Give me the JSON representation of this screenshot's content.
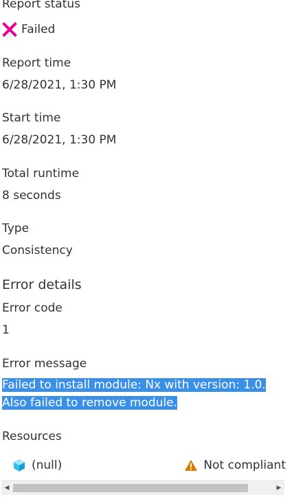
{
  "status": {
    "label": "Report status",
    "value": "Failed",
    "icon": "close-x-icon",
    "color": "#e3008c"
  },
  "report_time": {
    "label": "Report time",
    "value": "6/28/2021, 1:30 PM"
  },
  "start_time": {
    "label": "Start time",
    "value": "6/28/2021, 1:30 PM"
  },
  "total_runtime": {
    "label": "Total runtime",
    "value": "8 seconds"
  },
  "type": {
    "label": "Type",
    "value": "Consistency"
  },
  "error_details": {
    "title": "Error details",
    "code_label": "Error code",
    "code_value": "1",
    "message_label": "Error message",
    "message_lines": [
      "Failed to install module: Nx with version: 1.0.",
      "Also failed to remove module."
    ],
    "selection_color": "#3a8fe6"
  },
  "resources": {
    "label": "Resources",
    "items": [
      {
        "name": "(null)",
        "icon": "cube-icon",
        "compliance": "Not compliant",
        "compliance_icon": "warning-icon",
        "warning_color": "#d87a00"
      }
    ]
  }
}
